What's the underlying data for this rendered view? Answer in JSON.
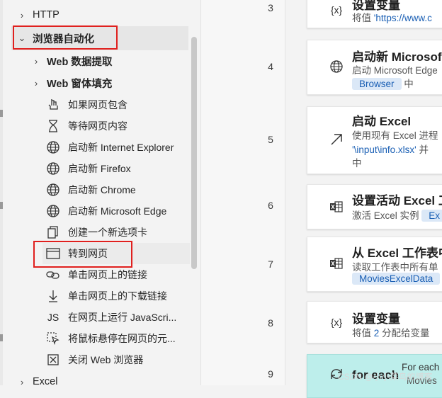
{
  "sidebar": {
    "top_items": [
      {
        "label": "HTTP",
        "expanded": false
      }
    ],
    "browser_category": {
      "label": "浏览器自动化",
      "expanded": true
    },
    "subcategories": [
      {
        "label": "Web 数据提取"
      },
      {
        "label": "Web 窗体填充"
      }
    ],
    "actions": [
      {
        "label": "如果网页包含",
        "icon": "hand-pointer-icon"
      },
      {
        "label": "等待网页内容",
        "icon": "hourglass-icon"
      },
      {
        "label": "启动新 Internet Explorer",
        "icon": "globe-icon"
      },
      {
        "label": "启动新 Firefox",
        "icon": "globe-icon"
      },
      {
        "label": "启动新 Chrome",
        "icon": "globe-icon"
      },
      {
        "label": "启动新 Microsoft Edge",
        "icon": "globe-icon"
      },
      {
        "label": "创建一个新选项卡",
        "icon": "new-tab-icon"
      },
      {
        "label": "转到网页",
        "icon": "browser-window-icon"
      },
      {
        "label": "单击网页上的链接",
        "icon": "link-icon"
      },
      {
        "label": "单击网页上的下载链接",
        "icon": "download-icon"
      },
      {
        "label": "在网页上运行 JavaScri...",
        "icon": "js-icon"
      },
      {
        "label": "将鼠标悬停在网页的元...",
        "icon": "hover-icon"
      },
      {
        "label": "关闭 Web 浏览器",
        "icon": "close-browser-icon"
      }
    ],
    "bottom_items": [
      {
        "label": "Excel",
        "expanded": false
      }
    ]
  },
  "flow": {
    "steps": [
      {
        "line": "3",
        "title": "设置变量",
        "sub_prefix": "将值 ",
        "sub_link": "'https://www.c",
        "icon": "{x}"
      },
      {
        "line": "4",
        "title": "启动新 Microsof",
        "sub": "启动 Microsoft Edge",
        "pill": "Browser",
        "pill_suffix": " 中",
        "icon": "globe-icon"
      },
      {
        "line": "5",
        "title": "启动 Excel",
        "sub": "使用现有 Excel 进程",
        "sub2_link": "'\\input\\info.xlsx'",
        "sub2_suffix": " 并",
        "sub3": "中",
        "icon": "arrow-up-right-icon"
      },
      {
        "line": "6",
        "title": "设置活动 Excel 工",
        "sub": "激活 Excel 实例 ",
        "pill": "Ex",
        "icon": "excel-icon"
      },
      {
        "line": "7",
        "title": "从 Excel 工作表中",
        "sub": "读取工作表中所有单",
        "pill": "MoviesExcelData",
        "icon": "excel-icon"
      },
      {
        "line": "8",
        "title": "设置变量",
        "sub_prefix": "将值 ",
        "sub_link": "2",
        "sub_suffix": " 分配给变量",
        "icon": "{x}"
      },
      {
        "line": "9",
        "title": "for each",
        "side_text": "For each",
        "side_link": "Movies",
        "icon": "loop-icon"
      }
    ]
  },
  "watermark": "CSDN @小小菜鸟的博客",
  "colors": {
    "highlight": "#e0201e",
    "link": "#1a5fb4",
    "loop_card": "#bdeeeb"
  }
}
